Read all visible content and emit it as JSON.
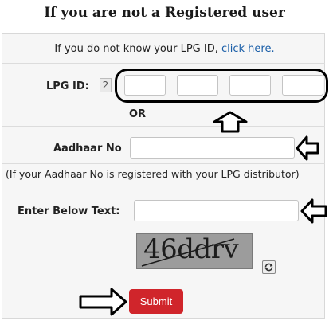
{
  "title": "If you are not a Registered user",
  "info": {
    "prefix": "If you do not know your LPG ID,",
    "link": "click here."
  },
  "lpg": {
    "label": "LPG ID:",
    "prefix_value": "2"
  },
  "or_text": "OR",
  "aadhaar": {
    "label": "Aadhaar No",
    "value": ""
  },
  "note": "(If your Aadhaar No is registered with your LPG distributor)",
  "captcha": {
    "label": "Enter Below Text:",
    "value": "",
    "image_text": "46ddrv"
  },
  "submit_label": "Submit",
  "icons": {
    "refresh": "refresh-icon",
    "arrow": "arrow-icon"
  },
  "colors": {
    "submit": "#d0252b",
    "link": "#1a5ea8",
    "panel": "#f6f6f6"
  }
}
